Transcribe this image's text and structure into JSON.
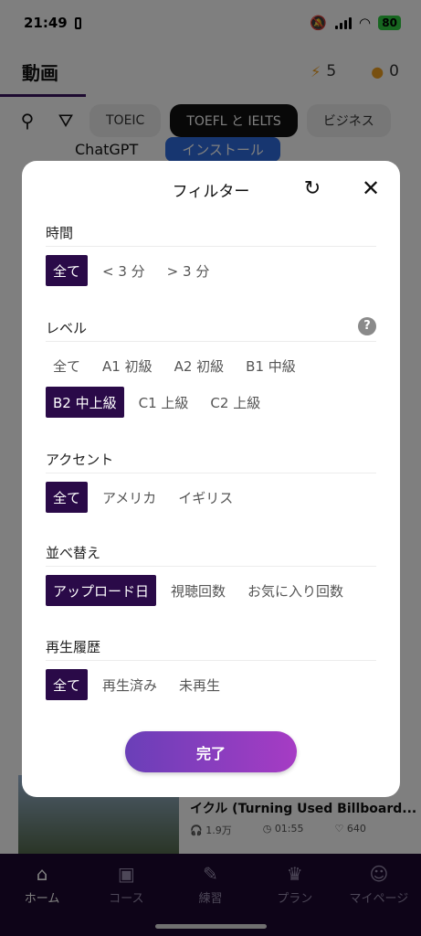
{
  "status_bar": {
    "time": "21:49",
    "battery": "80"
  },
  "header": {
    "title": "動画",
    "lightning_count": "5",
    "fire_count": "0"
  },
  "chips": [
    "TOEIC",
    "TOEFL と IELTS",
    "ビジネス"
  ],
  "ad": {
    "name": "ChatGPT",
    "install_label": "インストール"
  },
  "video": {
    "title": "イクル (Turning Used Billboard...",
    "listens": "1.9万",
    "duration": "01:55",
    "likes": "640"
  },
  "tabs": [
    {
      "label": "ホーム",
      "icon": "home-icon"
    },
    {
      "label": "コース",
      "icon": "course-icon"
    },
    {
      "label": "練習",
      "icon": "practice-icon"
    },
    {
      "label": "プラン",
      "icon": "crown-icon"
    },
    {
      "label": "マイページ",
      "icon": "user-icon"
    }
  ],
  "filter": {
    "title": "フィルター",
    "sections": [
      {
        "heading": "時間",
        "options": [
          "全て",
          "< 3 分",
          "> 3 分"
        ],
        "selected": 0
      },
      {
        "heading": "レベル",
        "options": [
          "全て",
          "A1 初級",
          "A2 初級",
          "B1 中級",
          "B2 中上級",
          "C1 上級",
          "C2 上級"
        ],
        "selected": 4
      },
      {
        "heading": "アクセント",
        "options": [
          "全て",
          "アメリカ",
          "イギリス"
        ],
        "selected": 0
      },
      {
        "heading": "並べ替え",
        "options": [
          "アップロード日",
          "視聴回数",
          "お気に入り回数"
        ],
        "selected": 0
      },
      {
        "heading": "再生履歴",
        "options": [
          "全て",
          "再生済み",
          "未再生"
        ],
        "selected": 0
      }
    ],
    "done_label": "完了"
  },
  "colors": {
    "selected": "#2a0a48",
    "button_start": "#6a3fb8",
    "button_end": "#a63cc4"
  }
}
